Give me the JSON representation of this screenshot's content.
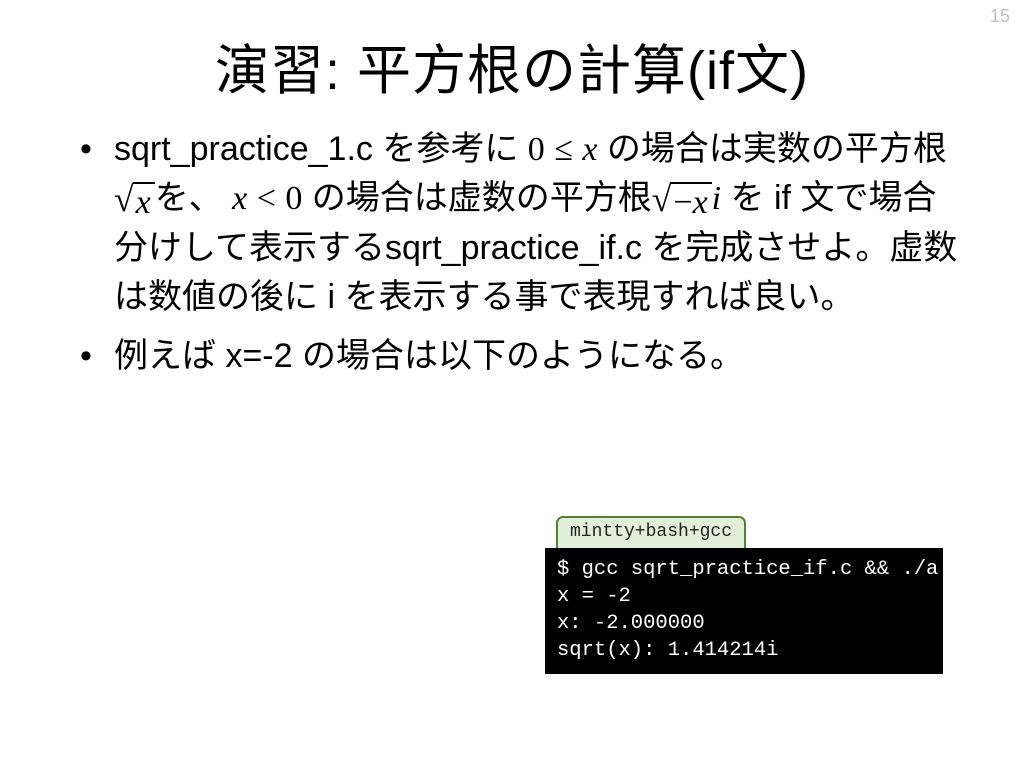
{
  "page_number": "15",
  "title": "演習: 平方根の計算(if文)",
  "bullet1": {
    "p1": "sqrt_practice_1.c を参考に ",
    "cond1_a": "0",
    "cond1_op": "≤",
    "cond1_b": "x",
    "p2": " の場合は実数の平方根",
    "sqrt1_rad": "x",
    "p3": "を、 ",
    "cond2_a": "x",
    "cond2_op": "<",
    "cond2_b": "0",
    "p4": " の場合は虚数の平方根",
    "sqrt2_rad": "−x",
    "sqrt2_suffix": "i",
    "p5": " を if 文で場合分けして表示するsqrt_practice_if.c を完成させよ。虚数は数値の後に i を表示する事で表現すれば良い。"
  },
  "bullet2": "例えば x=-2 の場合は以下のようになる。",
  "terminal": {
    "tag": "mintty+bash+gcc",
    "lines": "$ gcc sqrt_practice_if.c && ./a\nx = -2\nx: -2.000000\nsqrt(x): 1.414214i"
  }
}
